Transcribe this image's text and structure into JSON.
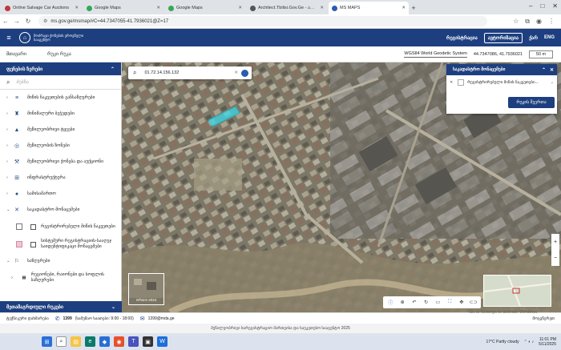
{
  "browser": {
    "tabs": [
      {
        "title": "Online Salvage Car Auctions",
        "color": "#c7343b",
        "active": false
      },
      {
        "title": "Google Maps",
        "color": "#34a853",
        "active": false
      },
      {
        "title": "Google Maps",
        "color": "#34a853",
        "active": false
      },
      {
        "title": "Architect.Tbilisi.Gov.Ge - არქიტ",
        "color": "#555555",
        "active": false
      },
      {
        "title": "MS MAPS",
        "color": "#2a5db0",
        "active": true
      }
    ],
    "new_tab": "+",
    "url": "ms.gov.ge/msmap/#C=44.7347055-41.7936021@Z=17"
  },
  "header": {
    "logo_text": "მოძრავი ქონების ეროვნული სააგენტო",
    "nav": [
      "რეგისტრაცია",
      "ავტორიზაცია",
      "ქარ",
      "ENG"
    ]
  },
  "subheader": {
    "tabs": [
      "მთავარი",
      "რუკი რუკა"
    ],
    "projection": "WGS84 World Geodetic System",
    "coords": "44.7347086, 41.7936021",
    "scale": "50 m"
  },
  "left_panel": {
    "title": "ფენების ზერები",
    "search_placeholder": "ძებნა",
    "layers": [
      {
        "label": "მიწის ნაკვეთების განსაზღვრები",
        "icon": "≡",
        "caret": "›"
      },
      {
        "label": "მინიმალური ბეჭედები",
        "icon": "♜",
        "caret": "›"
      },
      {
        "label": "მეწილეობრივი ტყეები",
        "icon": "▲",
        "caret": "›"
      },
      {
        "label": "მეწილეობის ზონები",
        "icon": "◎",
        "caret": "›"
      },
      {
        "label": "მეწილეობრივი ქონება და აუქციონი",
        "icon": "⚒",
        "caret": "›"
      },
      {
        "label": "ინფრასტრუქტურა",
        "icon": "⊞",
        "caret": "›"
      },
      {
        "label": "სამისამართო",
        "icon": "●",
        "caret": "›"
      },
      {
        "label": "საკადასტრო მონაცემები",
        "icon": "✕",
        "caret": "⌄"
      }
    ],
    "sublayers": [
      {
        "label": "რეგისტრირებული მიწის ნაკვეთები",
        "swatch": "#ffffff",
        "border": "#777777"
      },
      {
        "label": "სისტემური რეგისტრაციის-სააღეჯ საიდენტიფიკაცი მონაცემები",
        "swatch": "#f1c5d6",
        "border": "#d08aa6"
      }
    ],
    "group": {
      "label": "საზღვრები",
      "icon": "⚐",
      "caret": "⌄"
    },
    "group_item": {
      "label": "რეგიონები, რაიონები და სოფლის საზღვრები",
      "icon": "▦"
    },
    "footer": "მეთამაგრდიული რუკები"
  },
  "map": {
    "search_value": "01.72.14.156.132",
    "thumb_label": "ორთო 2024",
    "tools": [
      "ⓘ",
      "⊕",
      "↶",
      "↻",
      "▭",
      "⛶",
      "✥",
      "⊂⊃"
    ]
  },
  "right_panel": {
    "title": "საკადასტრო მონაცემები",
    "item": "რეგისტრირებული მიწის ნაკვეთები...",
    "button": "რუკის შეერთა"
  },
  "footer": {
    "items": [
      "ტექნიკური დახმარება",
      "1399",
      "(სამუშაო საათები: 9:00 - 18:00)",
      "1399@mda.ge"
    ],
    "right": "მოგვწერეთ"
  },
  "copyright": "მეწილეობრივი სარეგისტრაციო მართვისა და საუკეთესო სააგენტო 2025",
  "activate": "Go to Settings to activate Windows.",
  "taskbar": {
    "weather": "17°C  Partly cloudy",
    "time": "11:01 PM",
    "date": "5/11/2025"
  },
  "colors": {
    "primary": "#1d3f7f",
    "accent": "#2a5db0",
    "highlight": "#38d8e8"
  }
}
